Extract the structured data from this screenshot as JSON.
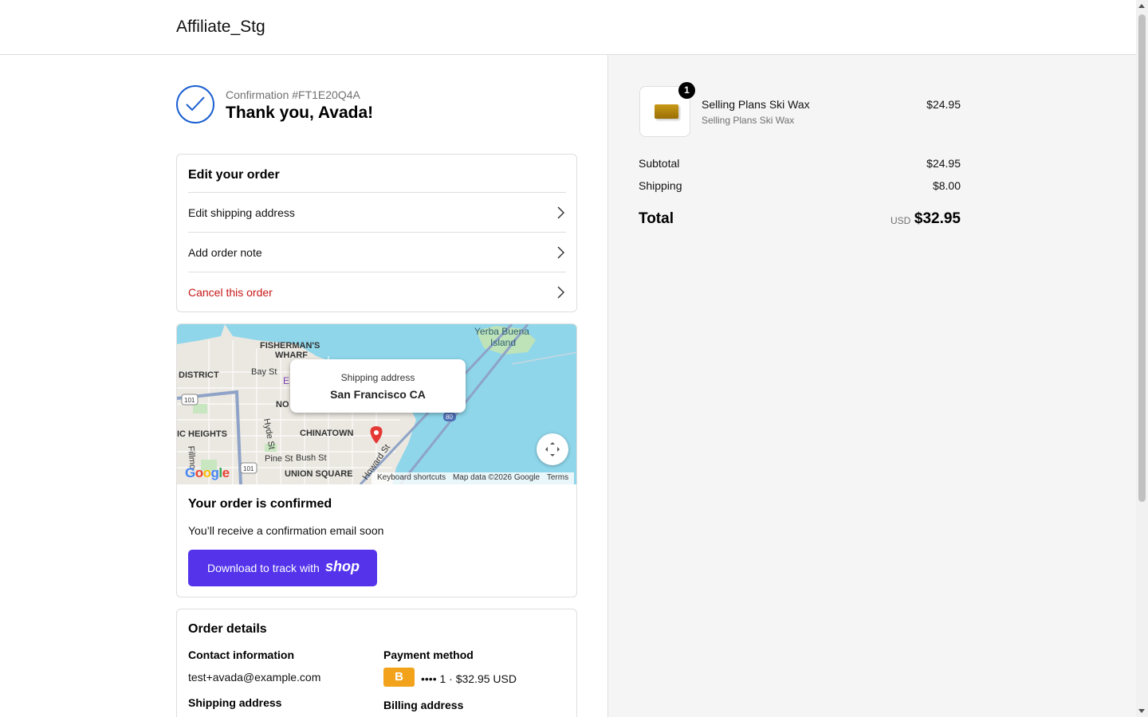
{
  "header": {
    "shop_name": "Affiliate_Stg"
  },
  "confirmation": {
    "number": "Confirmation #FT1E20Q4A",
    "thanks": "Thank you, Avada!"
  },
  "edit_order": {
    "title": "Edit your order",
    "items": [
      {
        "label": "Edit shipping address"
      },
      {
        "label": "Add order note"
      },
      {
        "label": "Cancel this order"
      }
    ]
  },
  "map": {
    "popup_label": "Shipping address",
    "popup_location": "San Francisco CA",
    "labels": {
      "fishermans": "FISHERMAN'S",
      "wharf": "WHARF",
      "district": "DISTRICT",
      "bay_st": "Bay St",
      "heights": "IC HEIGHTS",
      "chinatown": "CHINATOWN",
      "union_square": "UNION SQUARE",
      "hyde_st": "Hyde St",
      "pine_st": "Pine St",
      "bush_st": "Bush St",
      "howard_st": "Howard St",
      "fillmore": "Fillmo",
      "yerba": "Yerba Buena",
      "island": "Island",
      "no": "NO",
      "e": "E",
      "hw101a": "101",
      "hw101b": "101",
      "hw80": "80"
    },
    "google_logo": [
      "G",
      "o",
      "o",
      "g",
      "l",
      "e"
    ],
    "attribution": [
      "Keyboard shortcuts",
      "Map data ©2026 Google",
      "Terms"
    ]
  },
  "order_confirmed": {
    "title": "Your order is confirmed",
    "text": "You’ll receive a confirmation email soon",
    "button_text": "Download to track with",
    "button_brand": "shop"
  },
  "order_details": {
    "title": "Order details",
    "contact_label": "Contact information",
    "contact_value": "test+avada@example.com",
    "payment_label": "Payment method",
    "payment_badge": "B",
    "payment_value": "•••• 1 · $32.95 USD",
    "shipping_label": "Shipping address",
    "billing_label": "Billing address"
  },
  "summary": {
    "product_name": "Selling Plans Ski Wax",
    "product_variant": "Selling Plans Ski Wax",
    "product_price": "$24.95",
    "quantity": "1",
    "subtotal_label": "Subtotal",
    "subtotal_value": "$24.95",
    "shipping_label": "Shipping",
    "shipping_value": "$8.00",
    "total_label": "Total",
    "total_currency": "USD",
    "total_value": "$32.95"
  },
  "colors": {
    "accent_blue": "#1a5fd0",
    "shop_purple": "#5433eb",
    "cancel_red": "#c81818",
    "payment_badge": "#f2a31b"
  }
}
